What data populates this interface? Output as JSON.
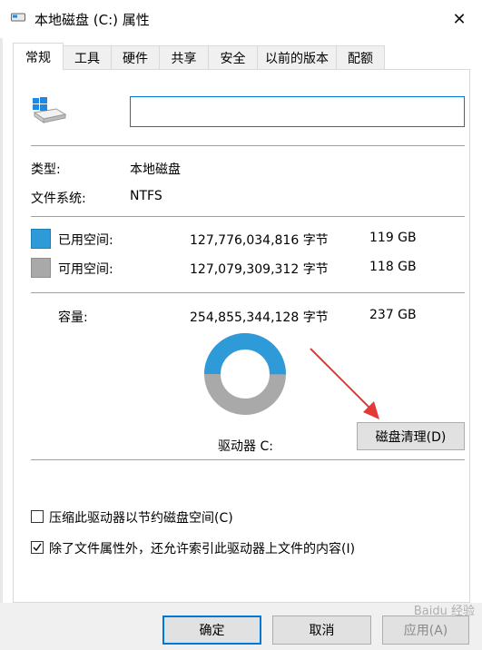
{
  "window": {
    "title": "本地磁盘 (C:) 属性",
    "close_glyph": "✕"
  },
  "tabs": [
    {
      "label": "常规",
      "active": true
    },
    {
      "label": "工具",
      "active": false
    },
    {
      "label": "硬件",
      "active": false
    },
    {
      "label": "共享",
      "active": false
    },
    {
      "label": "安全",
      "active": false
    },
    {
      "label": "以前的版本",
      "active": false
    },
    {
      "label": "配额",
      "active": false
    }
  ],
  "general": {
    "drive_name_value": "",
    "type_label": "类型:",
    "type_value": "本地磁盘",
    "fs_label": "文件系统:",
    "fs_value": "NTFS",
    "used": {
      "label": "已用空间:",
      "bytes": "127,776,034,816 字节",
      "size": "119 GB",
      "color": "#2e9bd8"
    },
    "free": {
      "label": "可用空间:",
      "bytes": "127,079,309,312 字节",
      "size": "118 GB",
      "color": "#a9a9a9"
    },
    "capacity": {
      "label": "容量:",
      "bytes": "254,855,344,128 字节",
      "size": "237 GB"
    },
    "used_fraction": 0.5014,
    "drive_label": "驱动器 C:",
    "cleanup_button": "磁盘清理(D)",
    "compress_label": "压缩此驱动器以节约磁盘空间(C)",
    "compress_checked": false,
    "index_label": "除了文件属性外，还允许索引此驱动器上文件的内容(I)",
    "index_checked": true
  },
  "buttons": {
    "ok": "确定",
    "cancel": "取消",
    "apply": "应用(A)"
  },
  "watermark": "Baidu 经验"
}
